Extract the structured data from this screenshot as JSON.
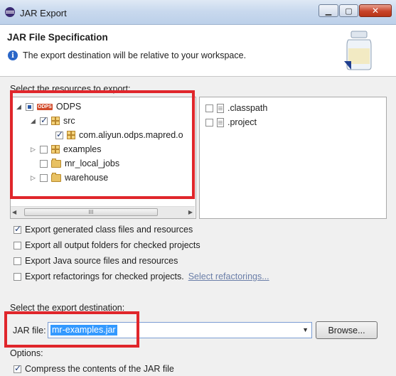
{
  "window": {
    "title": "JAR Export",
    "minimize_label": "▁",
    "maximize_label": "▢",
    "close_label": "✕"
  },
  "banner": {
    "title": "JAR File Specification",
    "info_icon": "i",
    "message": "The export destination will be relative to your workspace."
  },
  "resources": {
    "label": "Select the resources to export:",
    "tree": [
      {
        "label": "ODPS",
        "badge": "ODPS",
        "state": "partial",
        "expanded": true
      },
      {
        "label": "src",
        "state": "checked",
        "expanded": true
      },
      {
        "label": "com.aliyun.odps.mapred.o",
        "state": "checked"
      },
      {
        "label": "examples",
        "state": "unchecked",
        "expanded": false
      },
      {
        "label": "mr_local_jobs",
        "state": "unchecked"
      },
      {
        "label": "warehouse",
        "state": "unchecked",
        "expanded": false
      }
    ],
    "files": [
      {
        "label": ".classpath",
        "checked": false
      },
      {
        "label": ".project",
        "checked": false
      }
    ],
    "scroll_thumb_grip": "III"
  },
  "options_top": [
    {
      "label": "Export generated class files and resources",
      "checked": true
    },
    {
      "label": "Export all output folders for checked projects",
      "checked": false
    },
    {
      "label": "Export Java source files and resources",
      "checked": false
    },
    {
      "label": "Export refactorings for checked projects.",
      "checked": false,
      "link": "Select refactorings..."
    }
  ],
  "destination": {
    "label": "Select the export destination:",
    "jar_label": "JAR file:",
    "jar_value": "mr-examples.jar",
    "browse_label": "Browse..."
  },
  "options": {
    "label": "Options:",
    "compress_label": "Compress the contents of the JAR file",
    "compress_checked": true
  }
}
